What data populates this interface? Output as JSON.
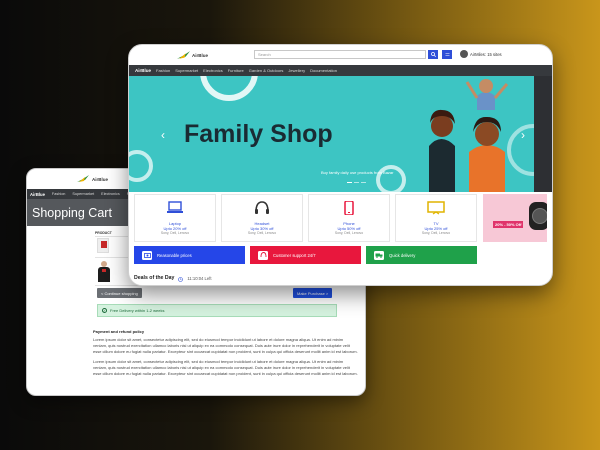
{
  "colors": {
    "accent_blue": "#2f4fd8",
    "banner_teal": "#3dc5c3",
    "nav_dark": "#36393d",
    "feature_blue": "#2546e8",
    "feature_red": "#e8173d",
    "feature_green": "#1fa14a",
    "promo_pink": "#e0346b"
  },
  "back_window": {
    "logo_text": "AirBlue",
    "nav": {
      "brand": "AirBlue",
      "items": [
        "Fashion",
        "Supermarket",
        "Electronics",
        "Furniture"
      ]
    },
    "hero_title": "Shopping Cart",
    "cart": {
      "product_header": "PRODUCT",
      "continue_label": "< Continue shopping",
      "purchase_label": "Make Purchase >",
      "delivery_text": "Free Delivery within 1-2 weeks"
    },
    "policy": {
      "title": "Payment and refund policy",
      "paragraphs": [
        "Lorem ipsum dolor sit amet, consectetur adipiscing elit, sed do eiusmod tempor incididunt ut labore et dolore magna aliqua. Ut enim ad minim veniam, quis nostrud exercitation ullamco laboris nisi ut aliquip ex ea commodo consequat. Duis aute irure dolor in reprehenderit in voluptate velit esse cillum dolore eu fugiat nulla pariatur. Excepteur sint occaecat cupidatat non proident, sunt in culpa qui officia deserunt mollit anim id est laborum.",
        "Lorem ipsum dolor sit amet, consectetur adipiscing elit, sed do eiusmod tempor incididunt ut labore et dolore magna aliqua. Ut enim ad minim veniam, quis nostrud exercitation ullamco laboris nisi ut aliquip ex ea commodo consequat. Duis aute irure dolor in reprehenderit in voluptate velit esse cillum dolore eu fugiat nulla pariatur. Excepteur sint occaecat cupidatat non proident, sunt in culpa qui officia deserunt mollit anim id est laborum."
      ]
    }
  },
  "front_window": {
    "logo_text": "AirBlue",
    "search_placeholder": "Search",
    "search_icon": "search-icon",
    "account_label": "AirMiles: 15 sites",
    "nav": {
      "brand": "AirBlue",
      "items": [
        "Fashion",
        "Supermarket",
        "Electronics",
        "Furniture",
        "Garden & Outdoors",
        "Jewellery",
        "Documentation"
      ]
    },
    "banner": {
      "title": "Family Shop",
      "subtitle": "Buy family daily use products from Bazar"
    },
    "categories": [
      {
        "name": "Laptop",
        "offer": "Upto 20% off",
        "brands": "Sony, Dell, Lenovo",
        "icon": "laptop-icon"
      },
      {
        "name": "Headset",
        "offer": "Upto 30% off",
        "brands": "Sony, Dell, Lenovo",
        "icon": "headset-icon"
      },
      {
        "name": "Phone",
        "offer": "Upto 50% off",
        "brands": "Sony, Dell, Lenovo",
        "icon": "phone-icon"
      },
      {
        "name": "TV",
        "offer": "Upto 25% off",
        "brands": "Sony, Dell, Lenovo",
        "icon": "tv-icon"
      }
    ],
    "promo_text": "20% - 50% Off",
    "features": [
      {
        "label": "Reasonable prices",
        "icon": "money-icon"
      },
      {
        "label": "Customer support 24/7",
        "icon": "headset-icon"
      },
      {
        "label": "Quick delivery",
        "icon": "truck-icon"
      }
    ],
    "deals": {
      "title": "Deals of the Day",
      "timer": "11:10:04 Left"
    }
  }
}
